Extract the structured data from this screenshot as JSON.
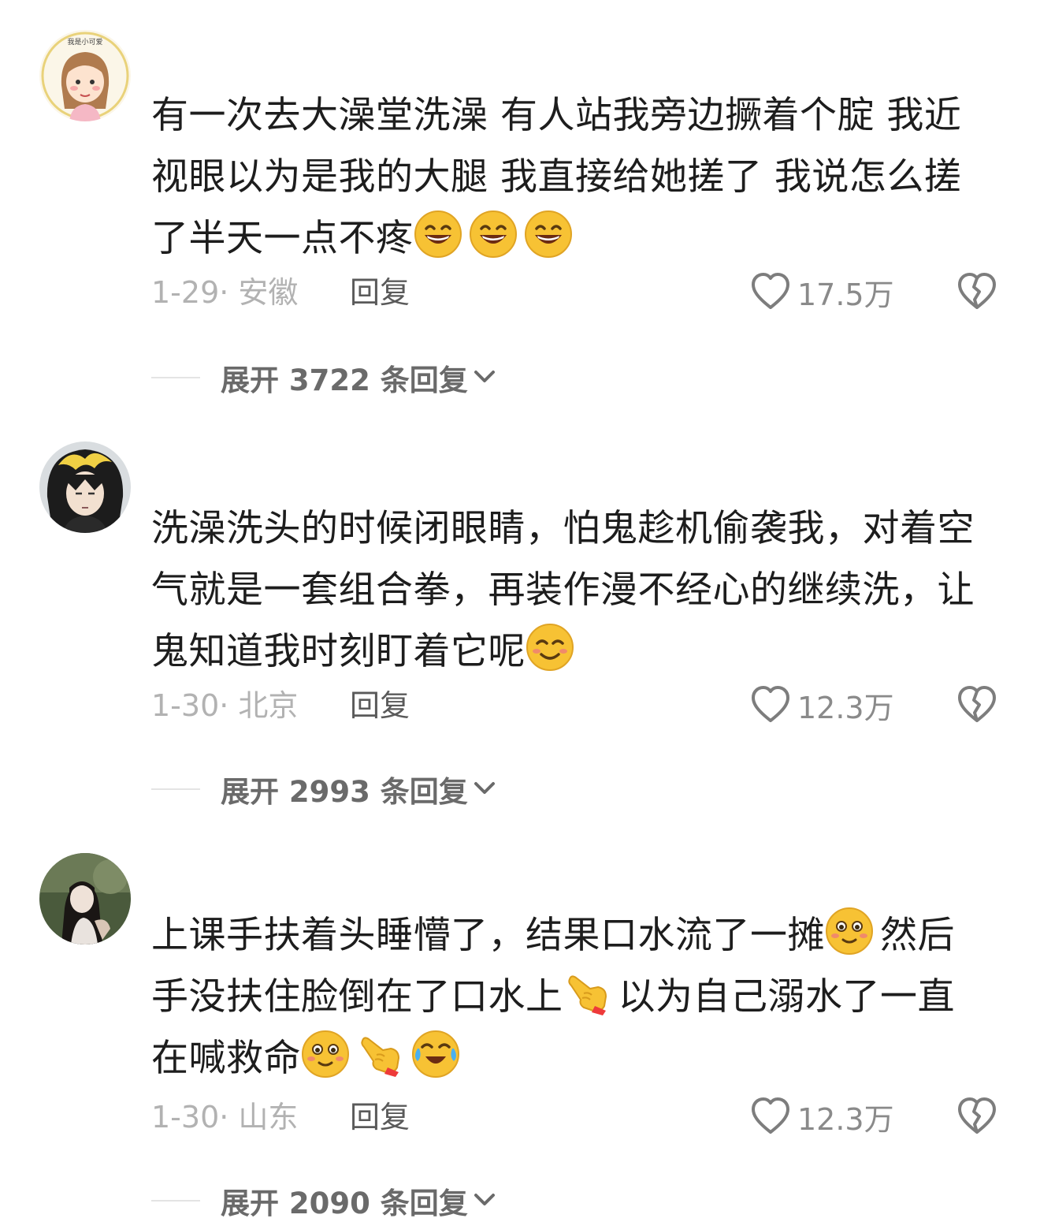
{
  "comments": [
    {
      "username": "",
      "avatar": "cartoon-girl-avatar",
      "lines": [
        "有一次去大澡堂洗澡 有人站我旁边撅着个腚 我近",
        "视眼以为是我的大腿 我直接给她搓了 我说怎么搓",
        "了半天一点不疼"
      ],
      "emojis": [
        "grin-emoji",
        "grin-emoji",
        "grin-emoji"
      ],
      "date_location": "1-29· 安徽",
      "reply_label": "回复",
      "likes": "17.5万",
      "expand_label": "展开 3722 条回复"
    },
    {
      "username": "",
      "avatar": "anime-character-avatar",
      "lines": [
        "洗澡洗头的时候闭眼睛，怕鬼趁机偷袭我，对着空",
        "气就是一套组合拳，再装作漫不经心的继续洗，让",
        "鬼知道我时刻盯着它呢"
      ],
      "emojis": [
        "smile-emoji"
      ],
      "date_location": "1-30· 北京",
      "reply_label": "回复",
      "likes": "12.3万",
      "expand_label": "展开 2993 条回复"
    },
    {
      "username": "",
      "avatar": "photo-girl-avatar",
      "lines": [
        "上课手扶着头睡懵了，结果口水流了一摊",
        "然后",
        "手没扶住脸倒在了口水上",
        "以为自己溺水了一直",
        "在喊救命"
      ],
      "emojis": [
        "blush-emoji",
        "pointing-hand-emoji",
        "blush-emoji",
        "pointing-hand-emoji",
        "laugh-cry-emoji"
      ],
      "date_location": "1-30· 山东",
      "reply_label": "回复",
      "likes": "12.3万",
      "expand_label": "展开 2090 条回复"
    }
  ],
  "icons": {
    "like": "heart-outline-icon",
    "dislike": "broken-heart-icon",
    "expand": "chevron-down-icon"
  },
  "colors": {
    "text": "#1d1d1d",
    "meta": "#b2b2b2",
    "emoji_yellow": "#f7c234"
  }
}
